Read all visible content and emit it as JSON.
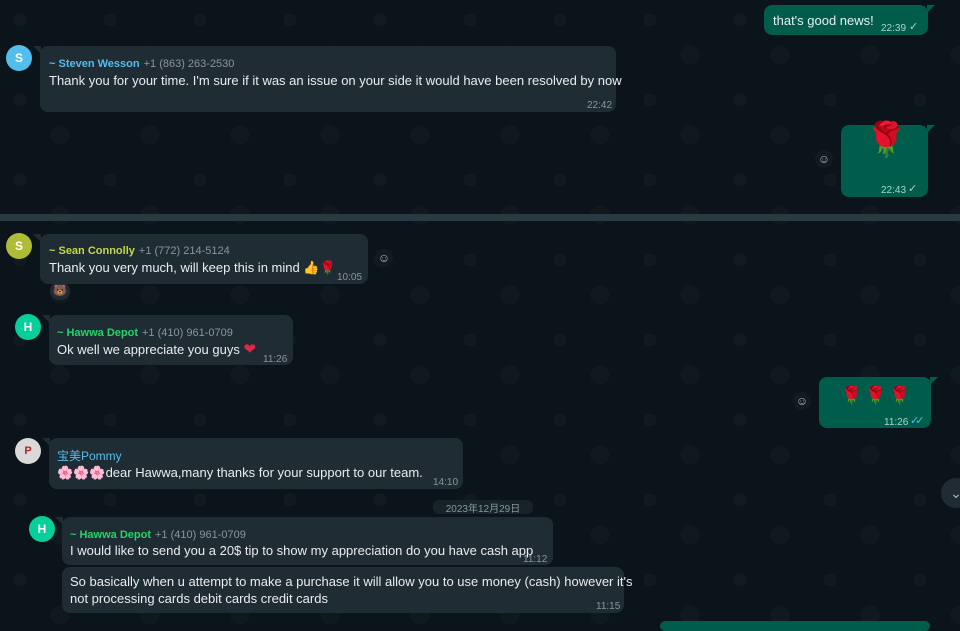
{
  "colors": {
    "chat_bg": "#0b141a",
    "incoming_bubble": "#202c33",
    "outgoing_bubble": "#005c4b",
    "read_tick": "#53bdeb",
    "name_steven": "#53bdeb",
    "name_sean": "#c4d843",
    "name_hawwa": "#25d366",
    "name_pommy": "#53bdeb"
  },
  "messages": {
    "m1": {
      "text": "that's good news!",
      "time": "22:39",
      "status": "sent-check-icon"
    },
    "m2": {
      "sender_name": "~ Steven Wesson",
      "sender_phone": "+1 (863) 263-2530",
      "avatar_letter": "S",
      "text": "Thank you for your time. I'm sure if it was an issue on your side it would have been resolved by now",
      "time": "22:42"
    },
    "m3": {
      "content": "rose-emoji",
      "time": "22:43",
      "status": "sent-check-icon"
    },
    "m4": {
      "sender_name": "~ Sean Connolly",
      "sender_phone": "+1 (772) 214-5124",
      "avatar_letter": "S",
      "text": "Thank you very much, will keep this in mind",
      "time": "10:05"
    },
    "m5": {
      "sender_name": "~ Hawwa Depot",
      "sender_phone": "+1 (410) 961-0709",
      "avatar_letter": "H",
      "text": "Ok well we appreciate you guys",
      "time": "11:26"
    },
    "m6": {
      "content": "three-rose-emojis",
      "time": "11:26",
      "status": "read-double-check-icon"
    },
    "m7": {
      "sender_name": "宝美Pommy",
      "text": "dear Hawwa,many thanks for your support to  our team.",
      "time": "14:10"
    },
    "date_chip": "2023年12月29日",
    "m8": {
      "sender_name": "~ Hawwa Depot",
      "sender_phone": "+1 (410) 961-0709",
      "avatar_letter": "H",
      "text": "I would like to send you a 20$ tip to show my appreciation do you have cash app",
      "time": "11:12"
    },
    "m9": {
      "line1": "So basically when u attempt to make a purchase it will allow you to use money (cash) however it's",
      "line2": "not  processing cards debit cards credit cards",
      "time": "11:15"
    }
  },
  "icons": {
    "single_tick": "✓",
    "double_tick": "✓✓",
    "emoji_button": "☺",
    "rose": "🌹",
    "thumbs_up": "👍",
    "heart": "❤",
    "blossom": "🌸",
    "scroll_down": "⌄",
    "reaction": "🐻"
  }
}
